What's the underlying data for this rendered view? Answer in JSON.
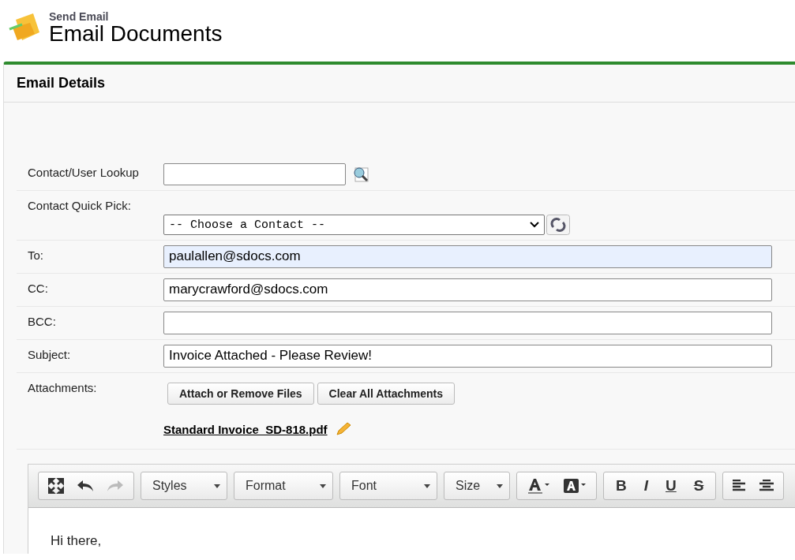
{
  "header": {
    "subtitle": "Send Email",
    "title": "Email Documents"
  },
  "panel": {
    "title": "Email Details"
  },
  "lookup": {
    "label": "Contact/User Lookup"
  },
  "quick_pick": {
    "label": "Contact Quick Pick:",
    "value": "-- Choose a Contact --"
  },
  "fields": [
    {
      "label": "To:",
      "value": "paulallen@sdocs.com",
      "highlighted": true
    },
    {
      "label": "CC:",
      "value": "marycrawford@sdocs.com",
      "highlighted": false
    },
    {
      "label": "BCC:",
      "highlighted": false
    },
    {
      "label": "Subject:",
      "value": "Invoice Attached - Please Review!",
      "highlighted": false
    }
  ],
  "attachments": {
    "label": "Attachments:",
    "buttons": [
      "Attach or Remove Files",
      "Clear All Attachments"
    ],
    "files": [
      "Standard Invoice_SD-818.pdf"
    ]
  },
  "toolbar": {
    "dropdowns": [
      "Styles",
      "Format",
      "Font",
      "Size"
    ],
    "styles": [
      "B",
      "I",
      "U",
      "S"
    ]
  },
  "body": {
    "text": "Hi there,"
  }
}
